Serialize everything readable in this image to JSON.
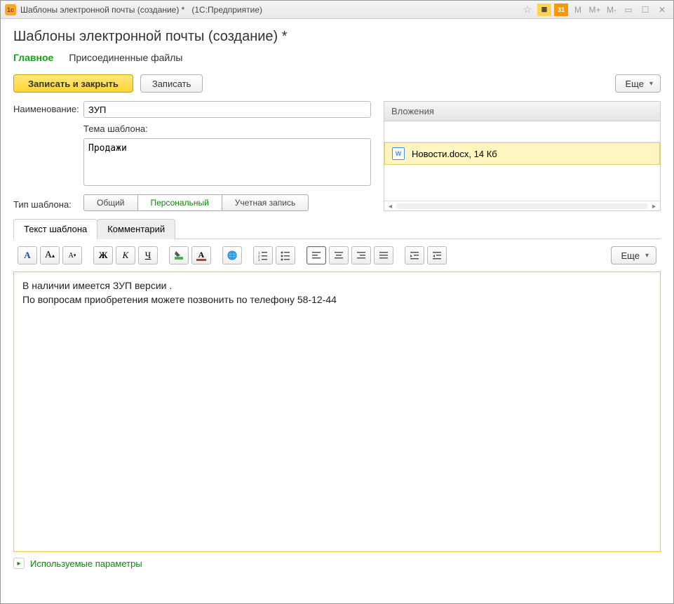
{
  "window": {
    "title": "Шаблоны электронной почты (создание) *",
    "app_suffix": "(1С:Предприятие)"
  },
  "titlebar_buttons": {
    "m": "M",
    "m_plus": "M+",
    "m_minus": "M-"
  },
  "page": {
    "title": "Шаблоны электронной почты (создание) *",
    "tabs": {
      "main": "Главное",
      "attached_files": "Присоединенные файлы"
    }
  },
  "toolbar": {
    "save_close": "Записать и закрыть",
    "save": "Записать",
    "more": "Еще"
  },
  "form": {
    "name_label": "Наименование:",
    "name_value": "ЗУП",
    "subject_label": "Тема шаблона:",
    "subject_value": "Продажи",
    "type_label": "Тип шаблона:",
    "type_options": {
      "common": "Общий",
      "personal": "Персональный",
      "account": "Учетная запись"
    }
  },
  "attachments": {
    "header": "Вложения",
    "items": [
      {
        "name": "Новости.docx, 14 Кб"
      }
    ]
  },
  "editor_tabs": {
    "text": "Текст шаблона",
    "comment": "Комментарий"
  },
  "editor_more": "Еще",
  "editor_content": {
    "line1": "В наличии имеется ЗУП версии    .",
    "line2": "По вопросам приобретения можете позвонить по телефону 58-12-44"
  },
  "params_link": "Используемые параметры"
}
